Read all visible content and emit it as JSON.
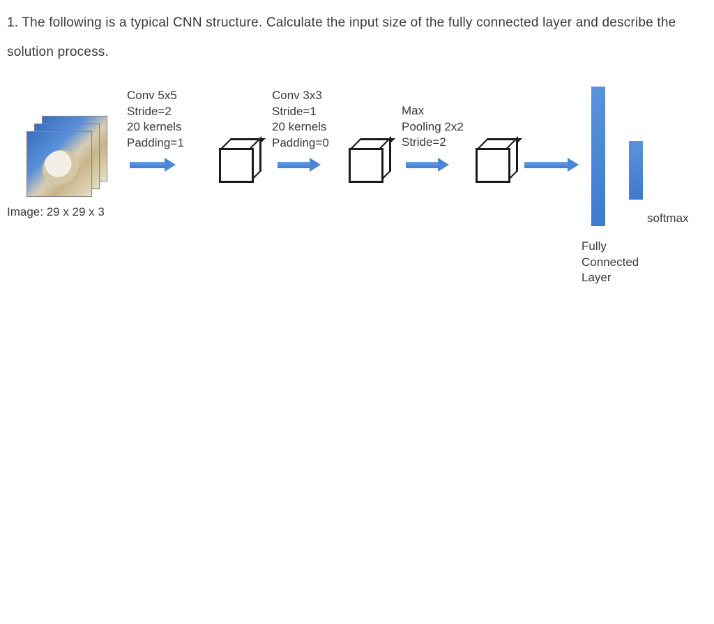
{
  "question": {
    "number_prefix": "1.",
    "text_line": "1. The following is a typical CNN structure. Calculate the input size of the fully connected layer and describe the solution process."
  },
  "input": {
    "caption": "Image: 29 x 29 x 3"
  },
  "stages": {
    "conv1": {
      "line1": "Conv 5x5",
      "line2": "Stride=2",
      "line3": "20 kernels",
      "line4": "Padding=1"
    },
    "conv2": {
      "line1": "Conv 3x3",
      "line2": "Stride=1",
      "line3": "20 kernels",
      "line4": "Padding=0"
    },
    "pool": {
      "line1": "Max",
      "line2": "Pooling 2x2",
      "line3": "Stride=2"
    },
    "fc": {
      "label_line1": "Fully",
      "label_line2": "Connected",
      "label_line3": "Layer"
    },
    "softmax": {
      "label": "softmax"
    }
  },
  "colors": {
    "arrow": "#4e86d6",
    "text": "#3a3a3a",
    "cube_stroke": "#1a1a1a"
  }
}
